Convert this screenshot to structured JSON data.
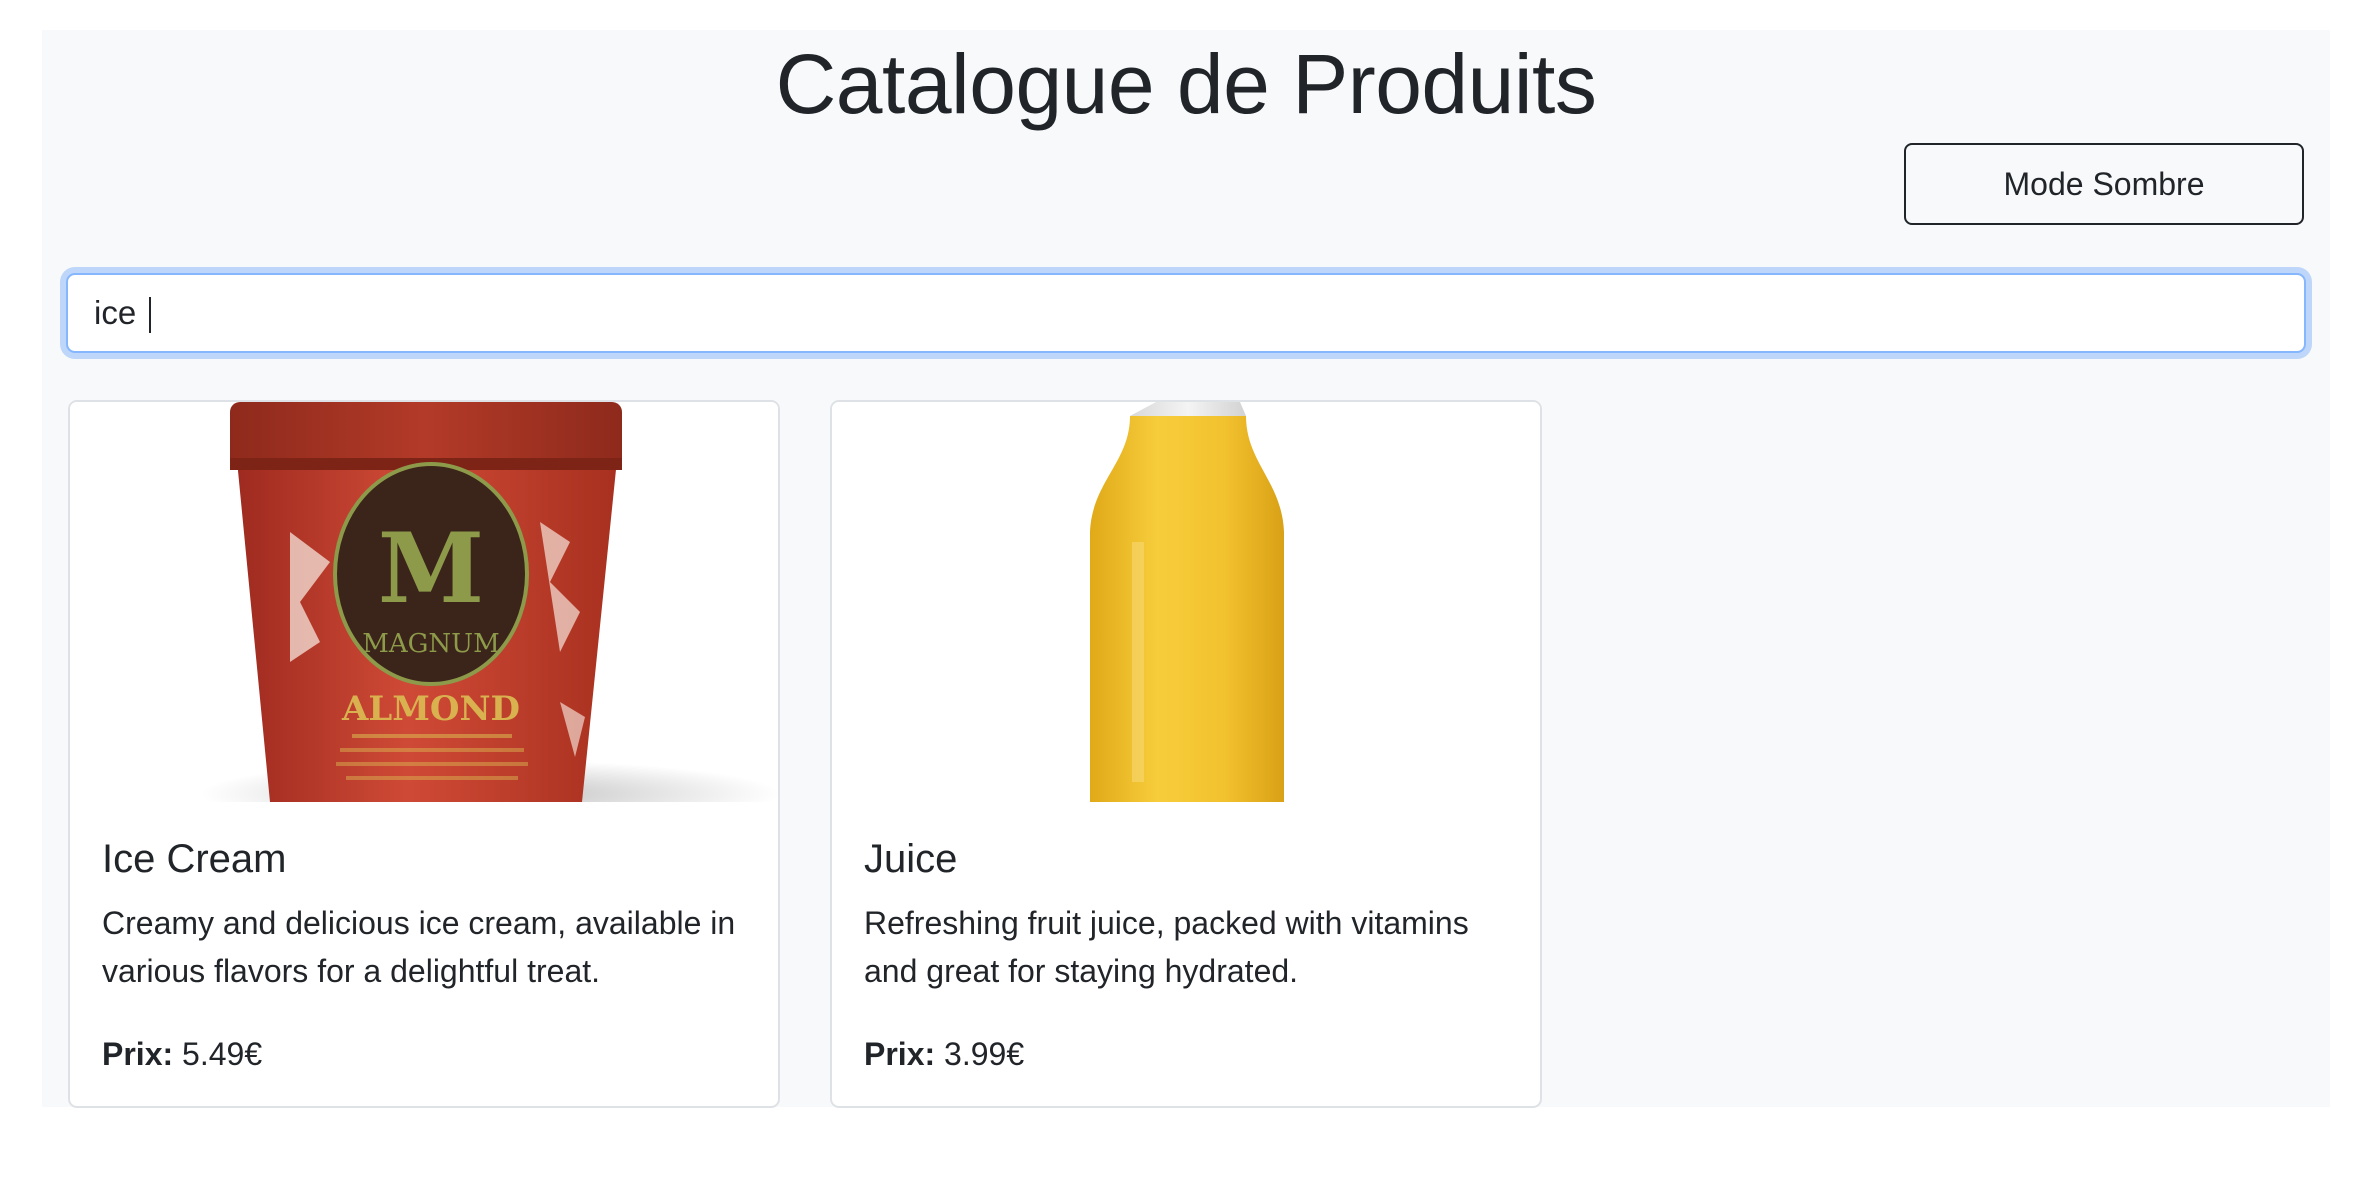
{
  "page": {
    "title": "Catalogue de Produits"
  },
  "toolbar": {
    "dark_mode_label": "Mode Sombre"
  },
  "search": {
    "value": "ice",
    "placeholder": ""
  },
  "products": [
    {
      "name": "Ice Cream",
      "description": "Creamy and delicious ice cream, available in various flavors for a delightful treat.",
      "price_label": "Prix:",
      "price": "5.49€",
      "image": {
        "icon": "ice-cream-tub-image",
        "brand_text": "MAGNUM",
        "flavor_text": "ALMOND",
        "tub_color": "#c0392b",
        "label_color": "#3b241a",
        "brand_color": "#8c9a4a"
      }
    },
    {
      "name": "Juice",
      "description": "Refreshing fruit juice, packed with vitamins and great for staying hydrated.",
      "price_label": "Prix:",
      "price": "3.99€",
      "image": {
        "icon": "juice-bottle-image",
        "bottle_color": "#f2c12e"
      }
    }
  ],
  "colors": {
    "page_background": "#f8f9fa",
    "text": "#212529",
    "focus_border": "#86b7fe",
    "card_border": "#dee2e6"
  }
}
